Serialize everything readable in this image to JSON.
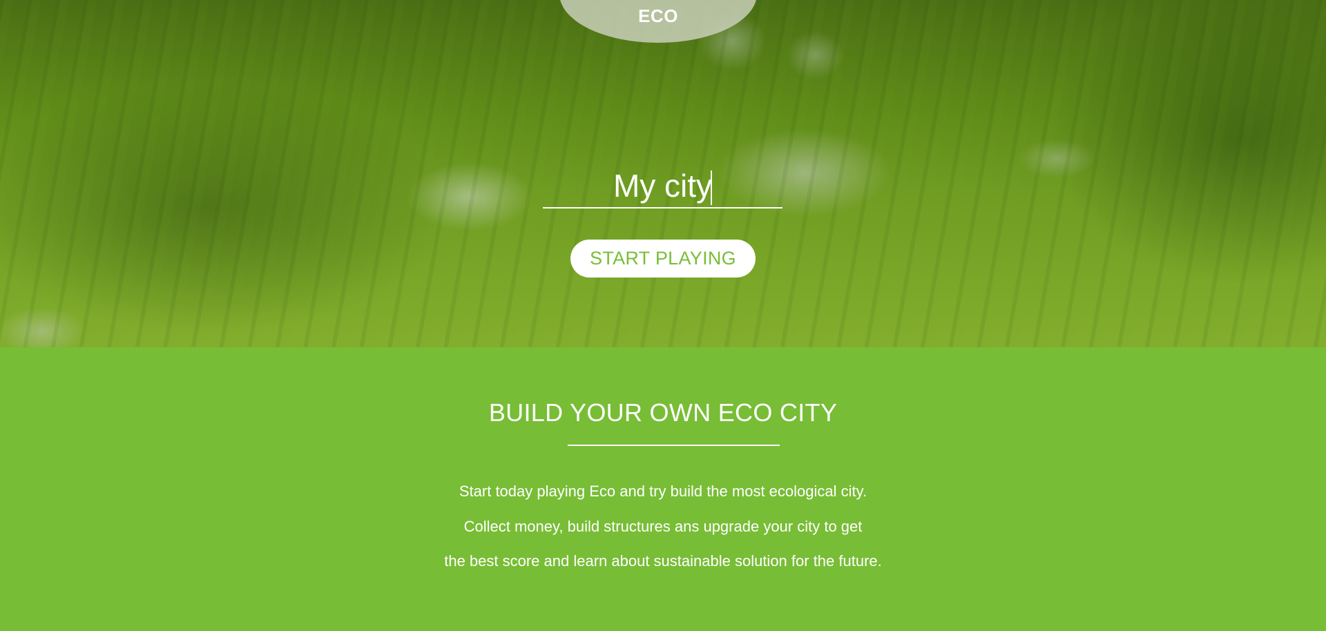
{
  "header": {
    "logo_text": "ECO"
  },
  "hero": {
    "city_input_value": "My city",
    "start_button_label": "START PLAYING"
  },
  "info": {
    "title": "BUILD YOUR OWN ECO CITY",
    "lines": [
      "Start today playing Eco and try build the most ecological city.",
      "Collect money, build structures ans upgrade your city to get",
      "the best score and learn about sustainable solution for the future."
    ]
  },
  "colors": {
    "accent_green": "#78bd36",
    "button_text": "#79bd35",
    "white": "#ffffff"
  }
}
